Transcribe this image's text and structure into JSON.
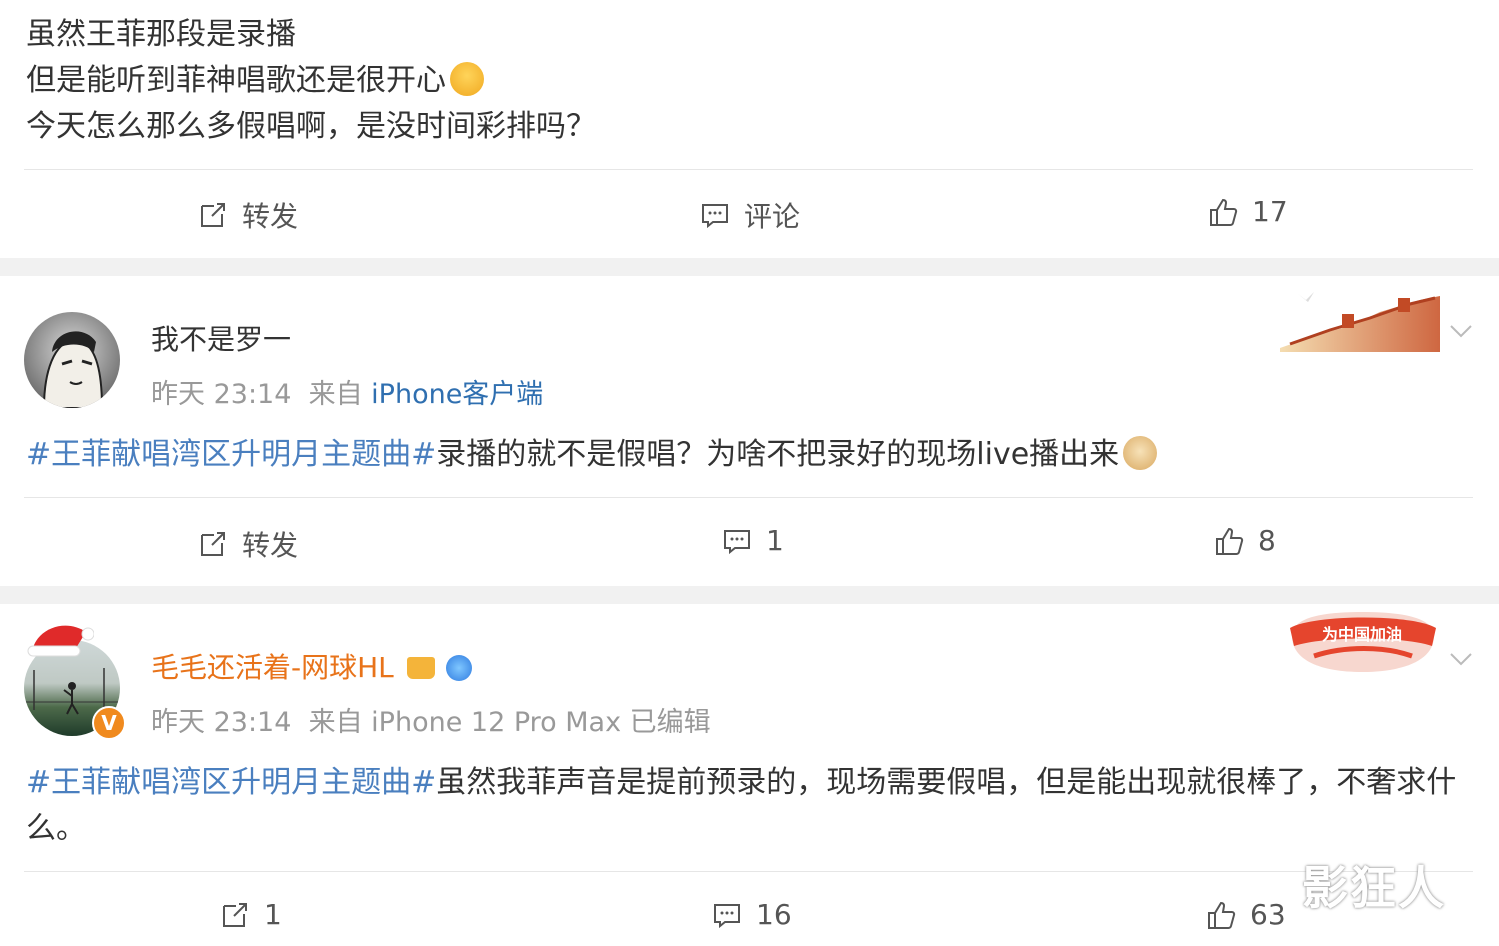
{
  "post1": {
    "lines": [
      "虽然王菲那段是录播",
      "但是能听到菲神唱歌还是很开心",
      "今天怎么那么多假唱啊，是没时间彩排吗？"
    ],
    "actions": {
      "repost": "转发",
      "comment": "评论",
      "like": "17"
    }
  },
  "post2": {
    "username": "我不是罗一",
    "time": "昨天 23:14",
    "from_prefix": "来自",
    "source": "iPhone客户端",
    "hashtag": "#王菲献唱湾区升明月主题曲#",
    "body": "录播的就不是假唱？为啥不把录好的现场live播出来",
    "actions": {
      "repost": "转发",
      "comment": "1",
      "like": "8"
    }
  },
  "post3": {
    "username": "毛毛还活着-网球HL",
    "time": "昨天 23:14",
    "from_prefix": "来自",
    "source": "iPhone 12 Pro Max",
    "edited": "已编辑",
    "hashtag": "#王菲献唱湾区升明月主题曲#",
    "body": "虽然我菲声音是提前预录的，现场需要假唱，但是能出现就很棒了，不奢求什么。",
    "badge_text": "为中国加油",
    "actions": {
      "repost": "1",
      "comment": "16",
      "like": "63"
    }
  },
  "watermark": "影狂人",
  "colors": {
    "hashtag": "#4a7fbf",
    "orange_name": "#e8731a",
    "meta": "#999999",
    "separator": "#f1f1f1"
  }
}
